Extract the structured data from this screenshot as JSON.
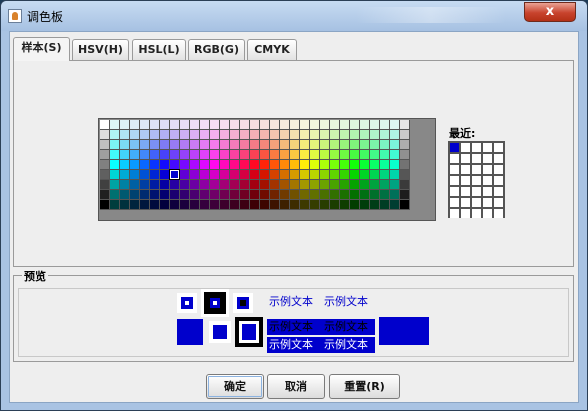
{
  "window": {
    "title": "调色板",
    "close_glyph": "x",
    "icon": "java-cup-icon"
  },
  "tabs": [
    {
      "label": "样本(S)",
      "active": true
    },
    {
      "label": "HSV(H)",
      "active": false
    },
    {
      "label": "HSL(L)",
      "active": false
    },
    {
      "label": "RGB(G)",
      "active": false
    },
    {
      "label": "CMYK",
      "active": false
    }
  ],
  "swatches": {
    "label": "",
    "selected": "#0000cc"
  },
  "recent": {
    "label": "最近:",
    "colors": [
      "#0000cc"
    ]
  },
  "preview": {
    "title": "预览",
    "sample_text": "示例文本",
    "color": "#0000cc"
  },
  "buttons": {
    "ok": "确定",
    "cancel": "取消",
    "reset": "重置(R)"
  }
}
